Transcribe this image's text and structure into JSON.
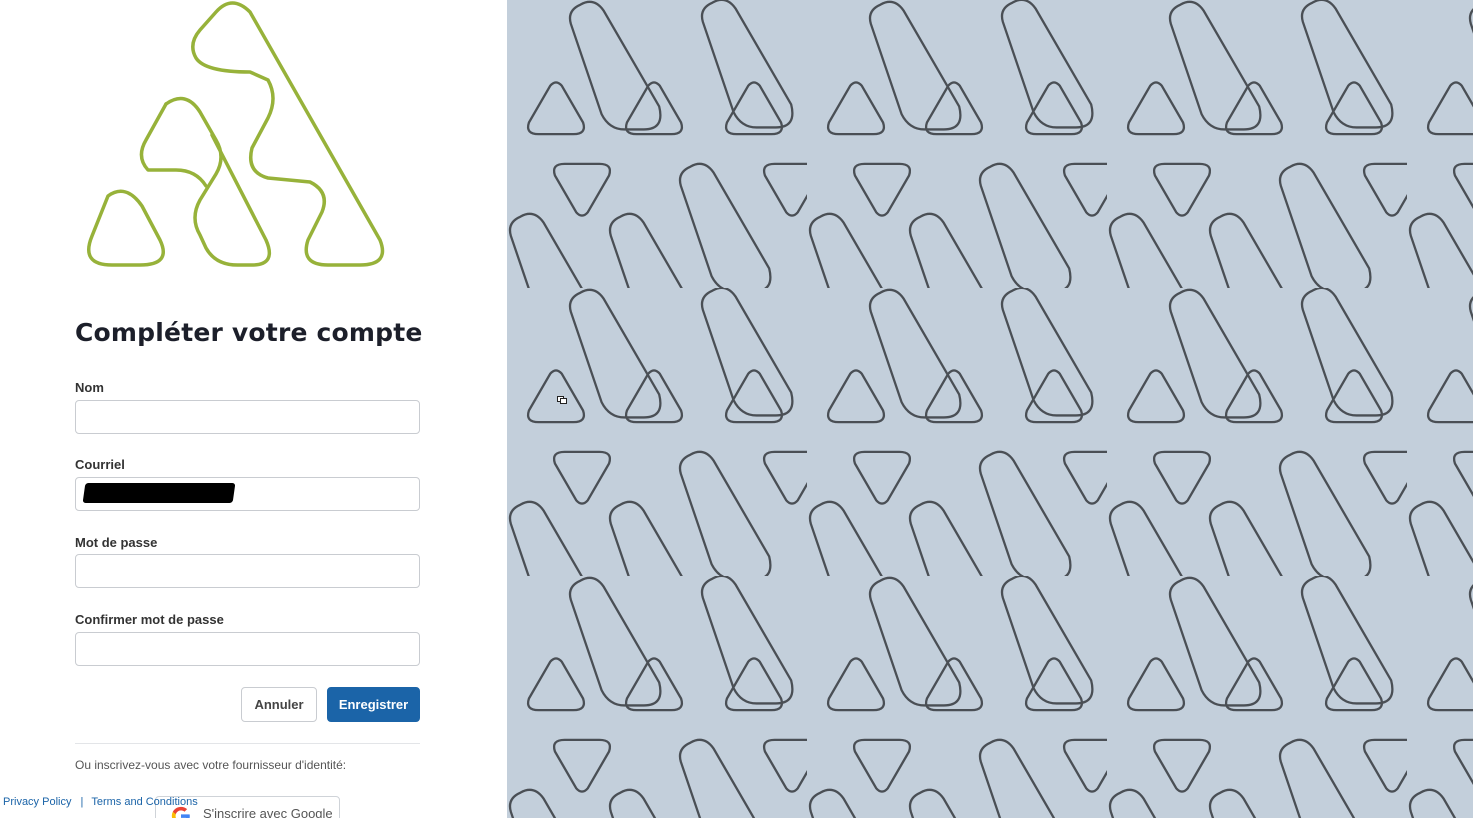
{
  "form": {
    "title": "Compléter votre compte",
    "fields": [
      {
        "label": "Nom",
        "value": ""
      },
      {
        "label": "Courriel",
        "value": ""
      },
      {
        "label": "Mot de passe",
        "value": ""
      },
      {
        "label": "Confirmer mot de passe",
        "value": ""
      }
    ],
    "cancel_label": "Annuler",
    "save_label": "Enregistrer",
    "or_text": "Ou inscrivez-vous avec votre fournisseur d'identité:",
    "google_label": "S'inscrire avec Google"
  },
  "footer": {
    "privacy": "Privacy Policy",
    "separator": "|",
    "terms": "Terms and Conditions"
  },
  "icons": {
    "logo": "triangle-loops-logo",
    "provider": "google-icon",
    "pointer": "cursor-icon"
  },
  "colors": {
    "logo": "#97b23a",
    "primary": "#1b64a8",
    "pattern_bg": "#c3cfdb",
    "pattern_stroke": "#4a4f55"
  }
}
